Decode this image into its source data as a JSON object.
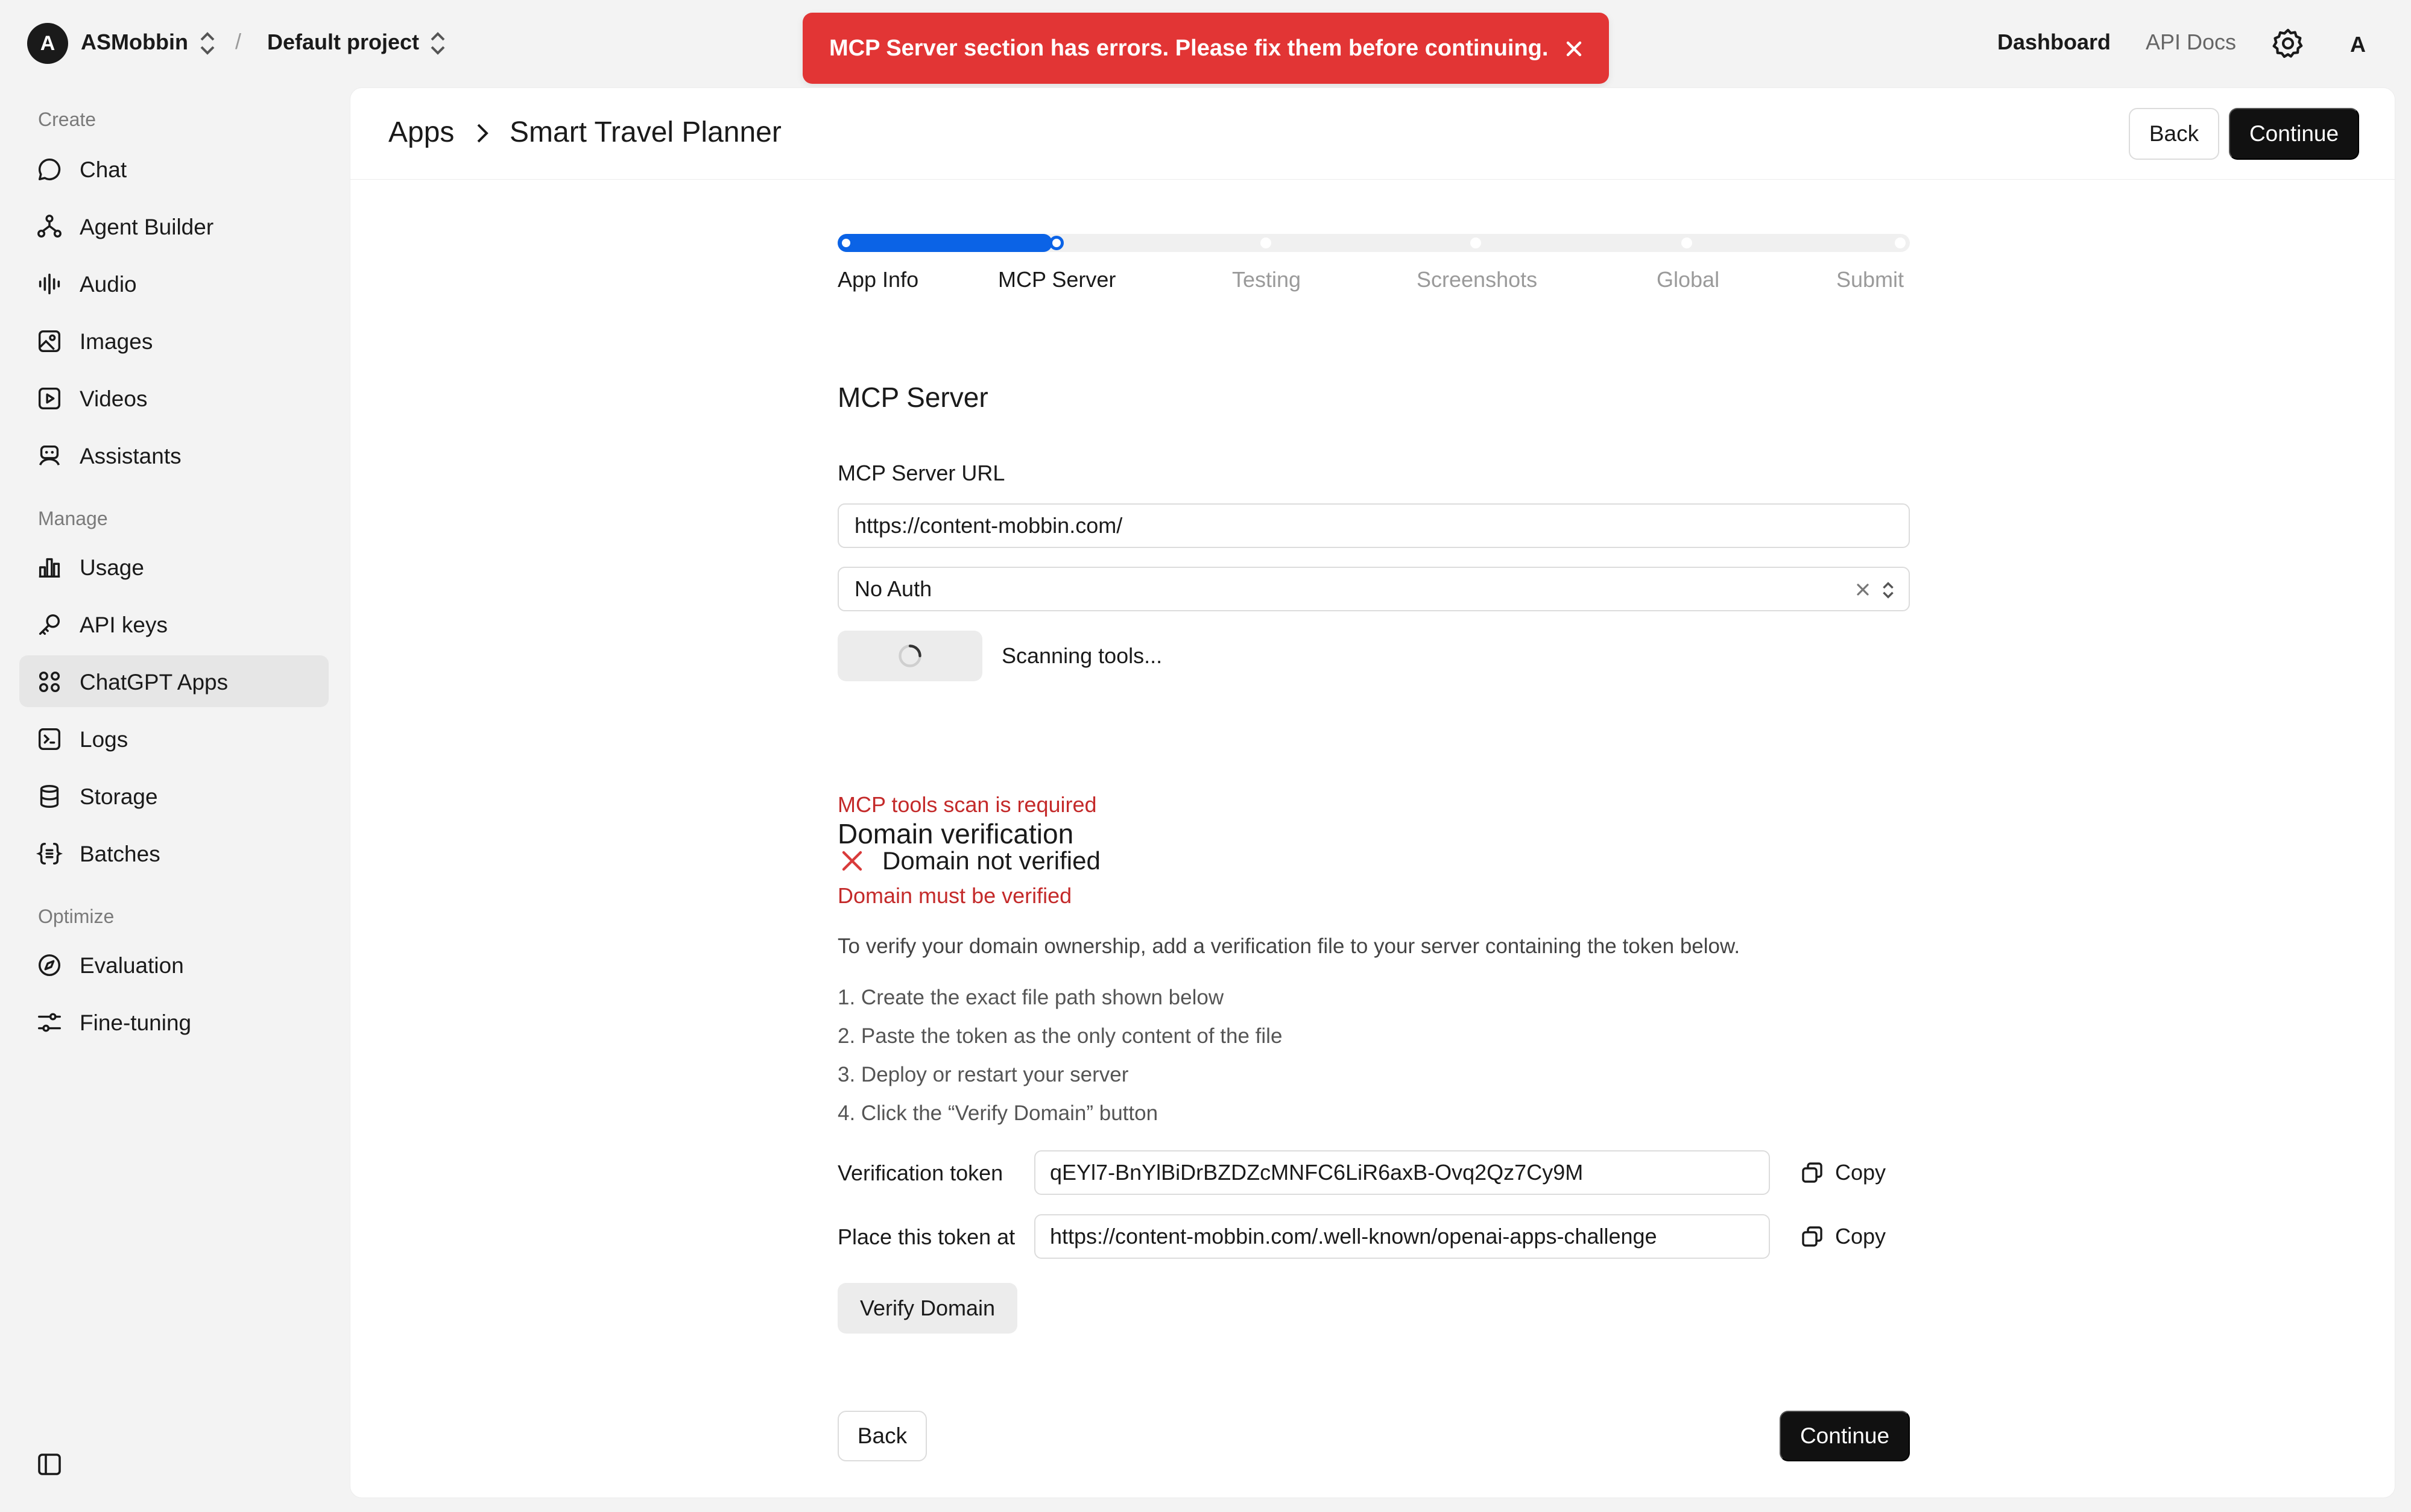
{
  "topbar": {
    "org_initial": "A",
    "org_name": "ASMobbin",
    "separator": "/",
    "project_name": "Default project",
    "toast_message": "MCP Server section has errors. Please fix them before continuing.",
    "dashboard_label": "Dashboard",
    "api_docs_label": "API Docs",
    "user_initial": "A"
  },
  "sidebar": {
    "sections": {
      "create": "Create",
      "manage": "Manage",
      "optimize": "Optimize"
    },
    "items": [
      {
        "label": "Chat",
        "icon": "chat-bubble-icon"
      },
      {
        "label": "Agent Builder",
        "icon": "agent-nodes-icon"
      },
      {
        "label": "Audio",
        "icon": "audio-waveform-icon"
      },
      {
        "label": "Images",
        "icon": "image-icon"
      },
      {
        "label": "Videos",
        "icon": "video-play-icon"
      },
      {
        "label": "Assistants",
        "icon": "robot-icon"
      },
      {
        "label": "Usage",
        "icon": "bar-chart-icon"
      },
      {
        "label": "API keys",
        "icon": "key-icon"
      },
      {
        "label": "ChatGPT Apps",
        "icon": "apps-grid-icon",
        "active": true
      },
      {
        "label": "Logs",
        "icon": "terminal-icon"
      },
      {
        "label": "Storage",
        "icon": "database-icon"
      },
      {
        "label": "Batches",
        "icon": "braces-icon"
      },
      {
        "label": "Evaluation",
        "icon": "compass-icon"
      },
      {
        "label": "Fine-tuning",
        "icon": "sliders-icon"
      }
    ]
  },
  "header": {
    "crumb_root": "Apps",
    "crumb_current": "Smart Travel Planner",
    "back_label": "Back",
    "continue_label": "Continue"
  },
  "stepper": {
    "steps": [
      "App Info",
      "MCP Server",
      "Testing",
      "Screenshots",
      "Global",
      "Submit"
    ],
    "current_index": 1,
    "progress_fraction": 0.2
  },
  "mcp": {
    "heading": "MCP Server",
    "url_label": "MCP Server URL",
    "url_value": "https://content-mobbin.com/",
    "auth_value": "No Auth",
    "scan_status": "Scanning tools...",
    "scan_error": "MCP tools scan is required"
  },
  "domain": {
    "heading": "Domain verification",
    "status": "Domain not verified",
    "error": "Domain must be verified",
    "description": "To verify your domain ownership, add a verification file to your server containing the token below.",
    "steps": [
      "1. Create the exact file path shown below",
      "2. Paste the token as the only content of the file",
      "3. Deploy or restart your server",
      "4. Click the “Verify Domain” button"
    ],
    "token_label": "Verification token",
    "token_value": "qEYl7-BnYlBiDrBZDZcMNFC6LiR6axB-Ovq2Qz7Cy9M",
    "place_label": "Place this token at",
    "place_value": "https://content-mobbin.com/.well-known/openai-apps-challenge",
    "copy_label": "Copy",
    "verify_button": "Verify Domain"
  },
  "footer": {
    "back_label": "Back",
    "continue_label": "Continue"
  },
  "colors": {
    "accent": "#0b63e6",
    "error": "#c42a2a",
    "toast": "#e23535"
  }
}
